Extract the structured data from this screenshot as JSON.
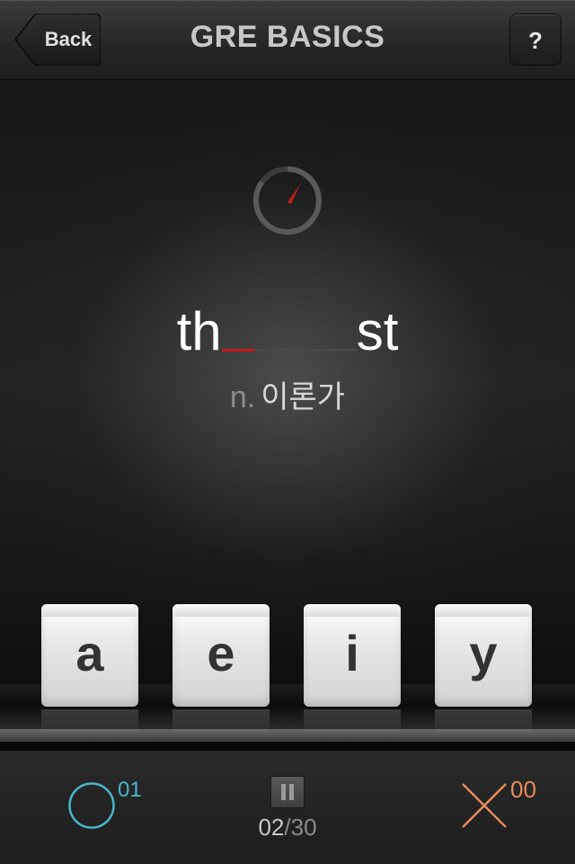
{
  "header": {
    "title": "GRE BASICS",
    "back_label": "Back",
    "help_label": "?"
  },
  "quiz": {
    "word_prefix": "th",
    "word_suffix": "st",
    "blank_count": 4,
    "part_of_speech": "n.",
    "meaning": "이론가"
  },
  "keys": [
    {
      "letter": "a"
    },
    {
      "letter": "e"
    },
    {
      "letter": "i"
    },
    {
      "letter": "y"
    }
  ],
  "footer": {
    "correct_count": "01",
    "wrong_count": "00",
    "current": "02",
    "separator": "/",
    "total": "30"
  },
  "colors": {
    "correct": "#4ab6cc",
    "wrong": "#e88a5c",
    "active_blank": "#c51a1a",
    "timer_needle": "#c51a1a"
  },
  "icons": {
    "timer": "stopwatch-icon",
    "correct": "circle-icon",
    "wrong": "cross-icon",
    "pause": "pause-icon"
  }
}
